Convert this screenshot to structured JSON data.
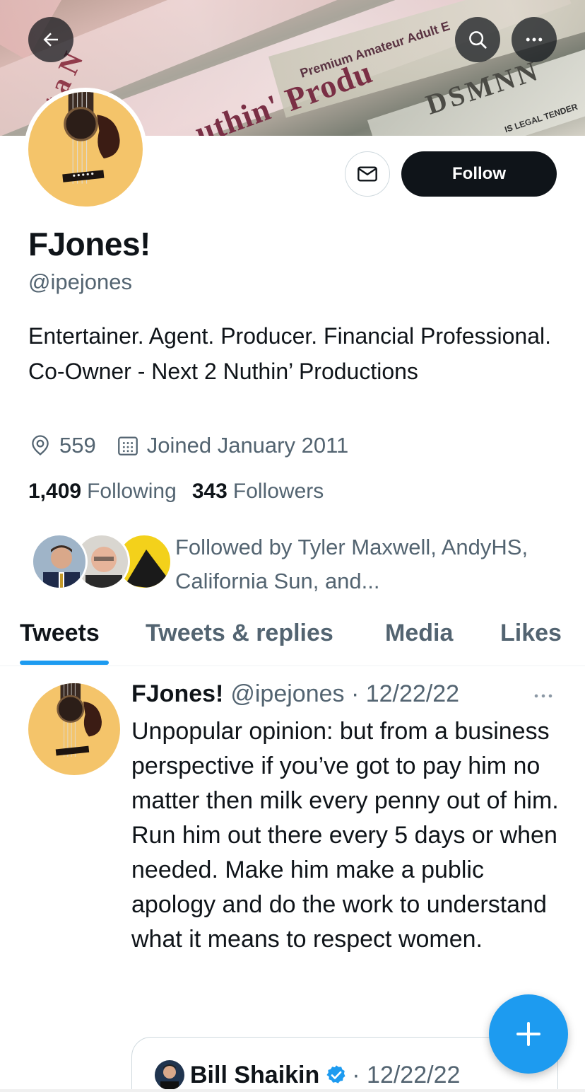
{
  "banner": {
    "text_main": "uthin' Produ",
    "text_side": "Next a N",
    "text_small": "Premium Amateur Adult E",
    "text_right": "DSMNN",
    "text_legal": "IS LEGAL TENDER"
  },
  "header": {
    "back_icon": "arrow-left-icon",
    "search_icon": "search-icon",
    "more_icon": "more-horizontal-icon"
  },
  "profile": {
    "display_name": "FJones!",
    "handle": "@ipejones",
    "bio": "Entertainer. Agent. Producer. Financial Professional. Co-Owner - Next 2 Nuthin’ Productions",
    "location": "559",
    "joined": "Joined January 2011",
    "following_count": "1,409",
    "following_label": "Following",
    "followers_count": "343",
    "followers_label": "Followers",
    "followed_by": "Followed by Tyler Maxwell, AndyHS, California Sun, and..."
  },
  "actions": {
    "follow_label": "Follow",
    "message_icon": "mail-icon"
  },
  "tabs": [
    {
      "label": "Tweets",
      "active": true
    },
    {
      "label": "Tweets & replies",
      "active": false
    },
    {
      "label": "Media",
      "active": false
    },
    {
      "label": "Likes",
      "active": false
    }
  ],
  "tweet": {
    "name": "FJones!",
    "handle_date": "@ipejones · 12/22/22",
    "text": "Unpopular opinion: but from a business perspective if you’ve got to pay him no matter then milk every penny out of him. Run him out there every 5 days or when needed. Make him make a public apology and do the work to understand what it means to respect women.",
    "quote": {
      "name": "Bill Shaikin",
      "date": "· 12/22/22"
    }
  },
  "colors": {
    "accent": "#1d9bf0",
    "text_primary": "#0f1419",
    "text_secondary": "#536471",
    "follow_bg": "#0f1419"
  }
}
